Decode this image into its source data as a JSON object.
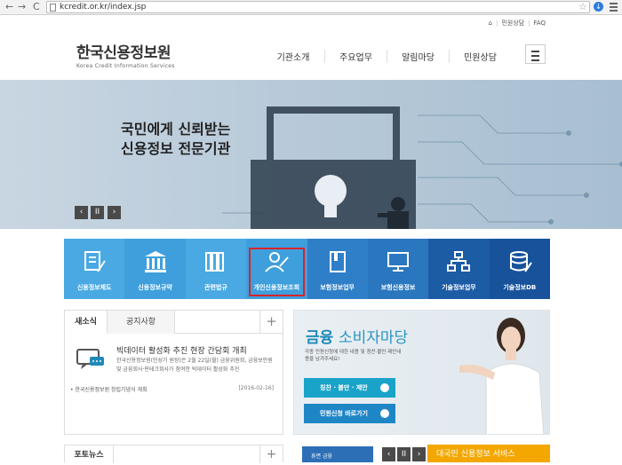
{
  "browser": {
    "url": "kcredit.or.kr/index.jsp",
    "back": "←",
    "forward": "→",
    "reload": "C"
  },
  "util": {
    "home": "⌂",
    "complaint": "민원상담",
    "faq": "FAQ",
    "sep": "|"
  },
  "logo": {
    "ko": "한국신용정보원",
    "en": "Korea Credit Information Services"
  },
  "gnb": [
    "기관소개",
    "주요업무",
    "알림마당",
    "민원상담"
  ],
  "hero": {
    "line1": "국민에게 신뢰받는",
    "line2": "신용정보 전문기관",
    "prev": "‹",
    "pause": "II",
    "next": "›"
  },
  "quick": [
    {
      "label": "신용정보제도",
      "bg": "#4aa9e3"
    },
    {
      "label": "신용정보규약",
      "bg": "#3f9fdc"
    },
    {
      "label": "관련법규",
      "bg": "#4aa9e3"
    },
    {
      "label": "개인신용정보조회",
      "bg": "#3f9fdc"
    },
    {
      "label": "보험정보업무",
      "bg": "#2f7fc8"
    },
    {
      "label": "보험신용정보",
      "bg": "#2a77bf"
    },
    {
      "label": "기술정보업무",
      "bg": "#1c5ca5"
    },
    {
      "label": "기술정보DB",
      "bg": "#17529a"
    }
  ],
  "news": {
    "tab_active": "새소식",
    "tab_other": "공지사항",
    "more": "+",
    "title": "빅데이터 활성화 추진 현장 간담회 개최",
    "desc": "한국신용정보원(민성기 원장)은 2월 22일(월) 금융위원회, 금융보안원 및 금융회사·핀테크회사가 참여한 빅데이터 활성화 추진",
    "item": "• 한국신용정보원 창립기념식 개최",
    "date": "[2016-02-16]"
  },
  "finance": {
    "title_bold": "금융",
    "title_rest": "소비자마당",
    "desc": "각종 민원신청에 대한 내용 및 청찬·불만·제안내용을 남겨주세요!",
    "btn1": "칭찬 · 불만 · 제안",
    "btn2": "민원신청 바로가기"
  },
  "photo": {
    "title": "포토뉴스",
    "more": "+",
    "thumb_text": "휴면 금융"
  },
  "pager": {
    "prev": "‹",
    "pause": "II",
    "next": "›"
  },
  "bottom_box": "대국민 신용정보 서비스",
  "colors": {
    "brand_blue": "#1f8ab8",
    "highlight_red": "#d8232a",
    "yellow": "#f4a700"
  }
}
